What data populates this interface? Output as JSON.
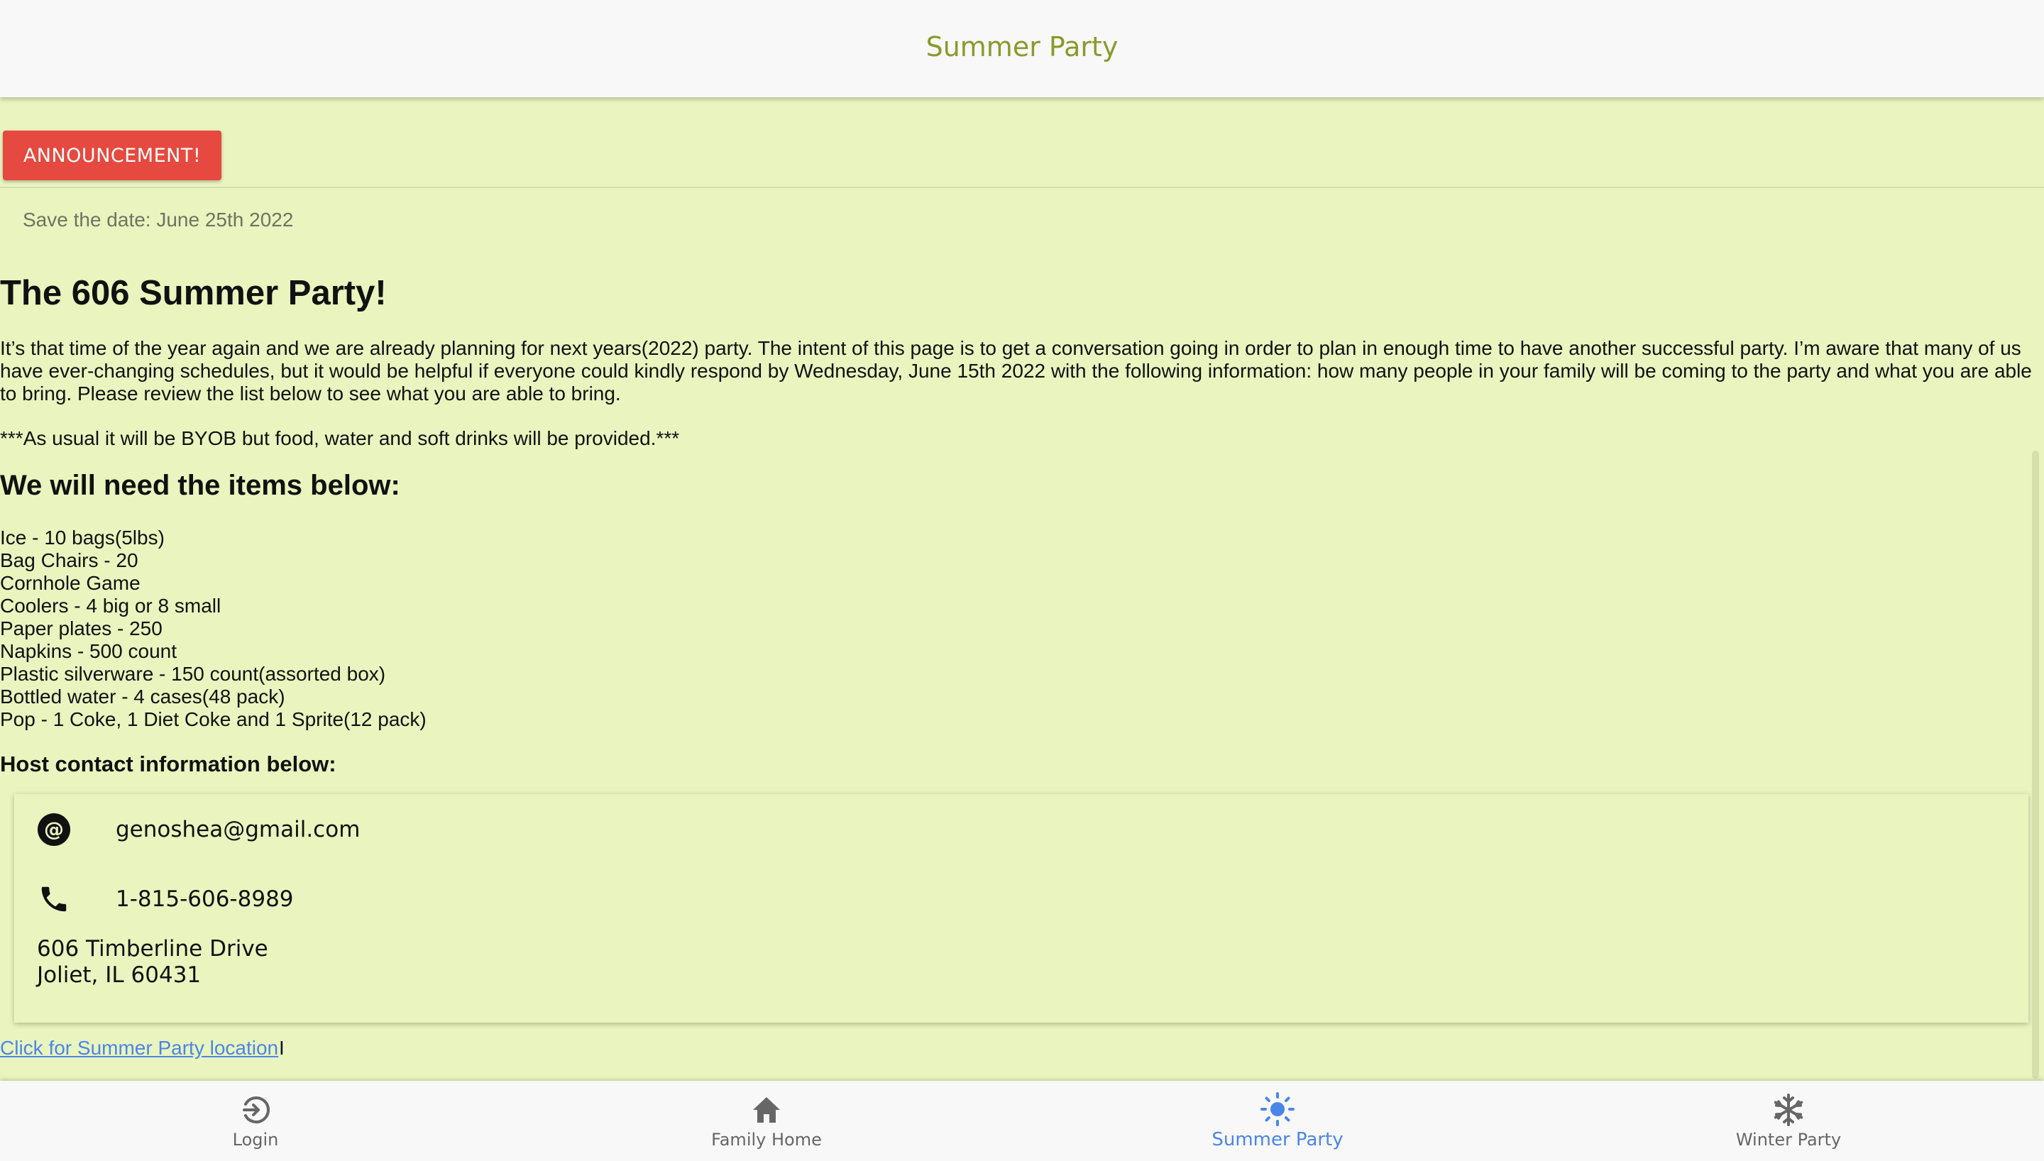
{
  "header": {
    "title": "Summer Party"
  },
  "main": {
    "announcement_label": "ANNOUNCEMENT!",
    "save_date": "Save the date: June 25th 2022",
    "headline": "The 606 Summer Party!",
    "intro": "It’s that time of the year again and we are already planning for next years(2022) party. The intent of this page is to get a conversation going in order to plan in enough time to have another successful party. I’m aware that many of us have ever-changing schedules, but it would be helpful if everyone could kindly respond by Wednesday, June 15th 2022 with the following information: how many people in your family will be coming to the party and what you are able to bring. Please review the list below to see what you are able to bring.",
    "byob_note": "***As usual it will be BYOB but food, water and soft drinks will be provided.***",
    "needs_heading": "We will need the items below:",
    "items": [
      "Ice - 10 bags(5lbs)",
      "Bag Chairs - 20",
      "Cornhole Game",
      "Coolers - 4 big or 8 small",
      "Paper plates - 250",
      "Napkins - 500 count",
      "Plastic silverware - 150 count(assorted box)",
      "Bottled water - 4 cases(48 pack)",
      "Pop - 1 Coke, 1 Diet Coke and 1 Sprite(12 pack)"
    ],
    "host_heading": "Host contact information below:",
    "contact": {
      "email": "genoshea@gmail.com",
      "phone": "1-815-606-8989",
      "address_line1": "606 Timberline Drive",
      "address_line2": "Joliet, IL 60431"
    },
    "location_link": "Click for Summer Party location",
    "cursor_char": "I"
  },
  "bottom_nav": {
    "items": [
      {
        "label": "Login",
        "icon": "login-icon",
        "active": false
      },
      {
        "label": "Family Home",
        "icon": "home-icon",
        "active": false
      },
      {
        "label": "Summer Party",
        "icon": "sun-icon",
        "active": true
      },
      {
        "label": "Winter Party",
        "icon": "snowflake-icon",
        "active": false
      }
    ]
  },
  "colors": {
    "background": "#e9f4bf",
    "title": "#8a9a2b",
    "announcement_button": "#e5493f",
    "active_nav": "#4a86e8",
    "link": "#4a86e8"
  }
}
